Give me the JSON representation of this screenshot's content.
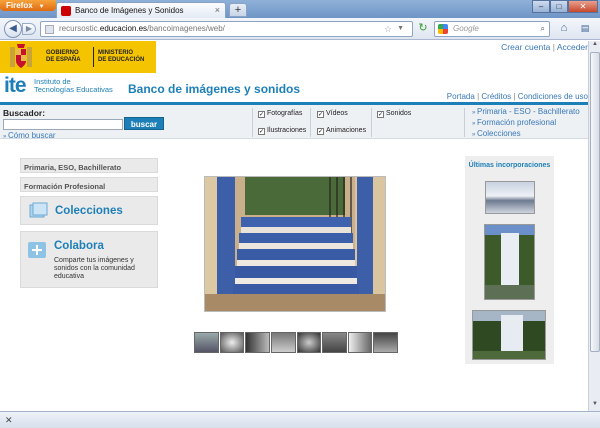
{
  "browser": {
    "menu_button": "Firefox",
    "tab_title": "Banco de Imágenes y Sonidos",
    "url_prefix": "recursostic.",
    "url_domain": "educacion.es",
    "url_path": "/bancoimagenes/web/",
    "search_placeholder": "Google",
    "status_close": "✕"
  },
  "header": {
    "gob_line1": "GOBIERNO",
    "gob_line2": "DE ESPAÑA",
    "min_line1": "MINISTERIO",
    "min_line2": "DE EDUCACIÓN",
    "crear_cuenta": "Crear cuenta",
    "separator": "|",
    "acceder": "Acceder",
    "ite_logo": "ite",
    "ite_line1": "Instituto de",
    "ite_line2": "Tecnologías Educativas",
    "site_title": "Banco de imágenes y sonidos",
    "nav": {
      "portada": "Portada",
      "creditos": "Créditos",
      "condiciones": "Condiciones de uso"
    }
  },
  "search": {
    "label": "Buscador:",
    "value": "",
    "button": "buscar",
    "help": "Cómo buscar",
    "types": [
      {
        "label": "Fotografías",
        "checked": true
      },
      {
        "label": "Ilustraciones",
        "checked": true
      },
      {
        "label": "Vídeos",
        "checked": true
      },
      {
        "label": "Animaciones",
        "checked": true
      },
      {
        "label": "Sonidos",
        "checked": true
      }
    ],
    "links": [
      "Primaria - ESO - Bachillerato",
      "Formación profesional",
      "Colecciones"
    ]
  },
  "left": {
    "primaria": "Primaria, ESO, Bachillerato",
    "fp": "Formación Profesional",
    "colecciones": "Colecciones",
    "colabora": "Colabora",
    "colabora_desc": "Comparte tus imágenes y sonidos con la comunidad educativa"
  },
  "right": {
    "title": "Últimas incorporaciones"
  },
  "colors": {
    "accent": "#1d7fb8",
    "gov_yellow": "#f5c400"
  }
}
